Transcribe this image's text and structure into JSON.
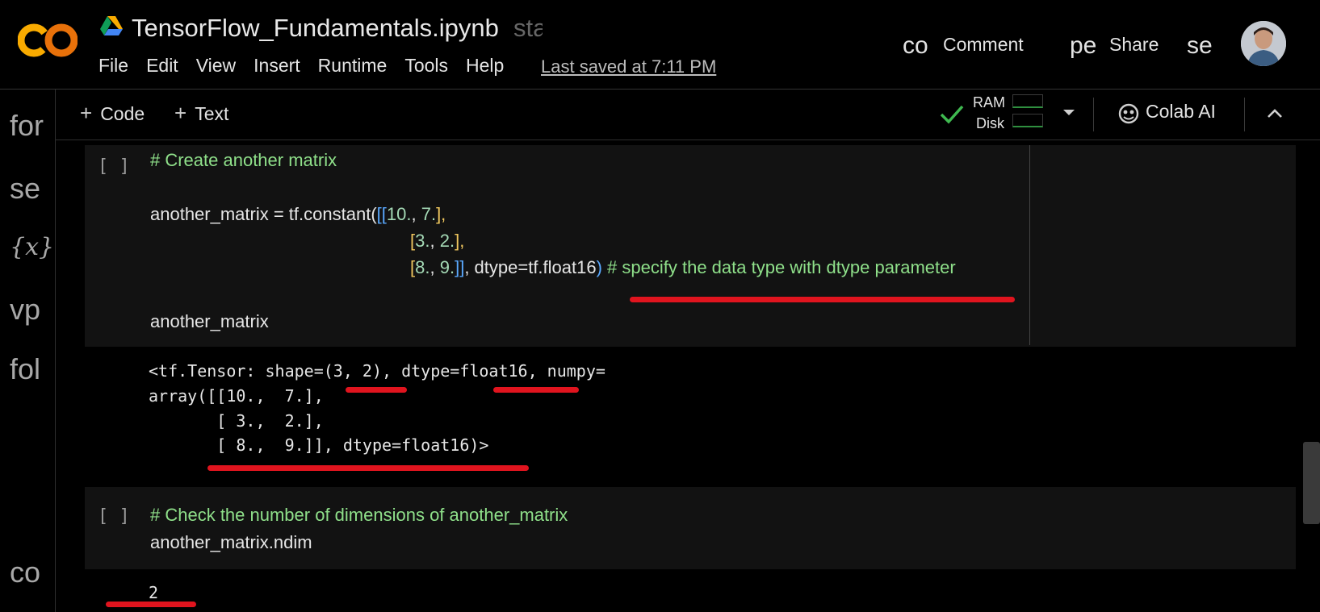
{
  "header": {
    "doc_title": "TensorFlow_Fundamentals.ipynb",
    "star_glyph": "sta",
    "menu": [
      "File",
      "Edit",
      "View",
      "Insert",
      "Runtime",
      "Tools",
      "Help"
    ],
    "last_saved": "Last saved at 7:11 PM",
    "comment_glyph": "co",
    "comment_label": "Comment",
    "share_glyph": "pe",
    "share_label": "Share",
    "settings_glyph": "se"
  },
  "left_rail": {
    "items": [
      "for",
      "se",
      "{x}",
      "vp",
      "fol",
      "co"
    ]
  },
  "toolbar": {
    "add_code": "Code",
    "add_text": "Text",
    "ram_label": "RAM",
    "disk_label": "Disk",
    "colab_ai": "Colab AI"
  },
  "cells": [
    {
      "run_bracket": "[ ]",
      "comment": "# Create another matrix",
      "line2": "another_matrix = tf.constant(",
      "line2_open": "[[",
      "line2_a": "10.",
      "line2_sep": ", ",
      "line2_b": "7.",
      "line2_close": "],",
      "line3_open": "[",
      "line3_a": "3.",
      "line3_sep": ", ",
      "line3_b": "2.",
      "line3_close": "],",
      "line4_open": "[",
      "line4_a": "8.",
      "line4_sep": ", ",
      "line4_b": "9.",
      "line4_close": "]]",
      "line4_tail": ", dtype=tf.float16",
      "line4_paren": ")",
      "line4_comment": " # specify the data type with dtype parameter",
      "last_line": "another_matrix",
      "output": [
        "<tf.Tensor: shape=(3, 2), dtype=float16, numpy=",
        "array([[10.,  7.],",
        "       [ 3.,  2.],",
        "       [ 8.,  9.]], dtype=float16)>"
      ]
    },
    {
      "run_bracket": "[ ]",
      "comment": "# Check the number of dimensions of another_matrix",
      "code": "another_matrix.ndim",
      "output": "2"
    }
  ],
  "colors": {
    "background": "#000000",
    "cell_background": "#121212",
    "comment_green": "#8fe08a",
    "annotation_red": "#e0141e",
    "logo_orange": "#f9ab00"
  }
}
